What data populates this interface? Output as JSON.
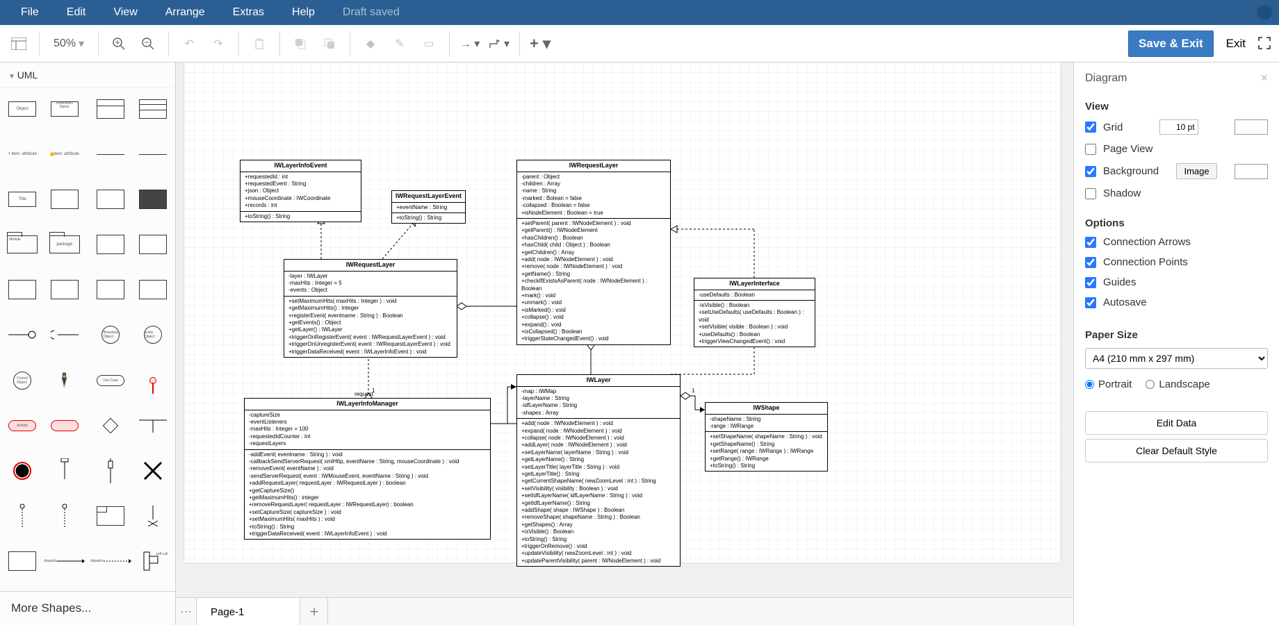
{
  "menu": {
    "file": "File",
    "edit": "Edit",
    "view": "View",
    "arrange": "Arrange",
    "extras": "Extras",
    "help": "Help",
    "draft": "Draft saved"
  },
  "toolbar": {
    "zoom": "50%",
    "save": "Save & Exit",
    "exit": "Exit"
  },
  "sidebar": {
    "category": "UML",
    "more": "More Shapes..."
  },
  "tabs": {
    "page1": "Page-1"
  },
  "rpanel": {
    "title": "Diagram",
    "view_h": "View",
    "grid": "Grid",
    "grid_val": "10 pt",
    "pageview": "Page View",
    "background": "Background",
    "image_btn": "Image",
    "shadow": "Shadow",
    "options_h": "Options",
    "connarrows": "Connection Arrows",
    "connpoints": "Connection Points",
    "guides": "Guides",
    "autosave": "Autosave",
    "papersize_h": "Paper Size",
    "papersize": "A4 (210 mm x 297 mm)",
    "portrait": "Portrait",
    "landscape": "Landscape",
    "editdata": "Edit Data",
    "cleardefault": "Clear Default Style"
  },
  "uml": {
    "iwlayerinfoevent": {
      "title": "IWLayerInfoEvent",
      "attrs": "+requestedId : int\n+requestedEvent : String\n+json : Object\n+mouseCoordinate : IWCoordinate\n+records : int",
      "ops": "+toString() : String"
    },
    "iwrequestlayerevent": {
      "title": "IWRequestLayerEvent",
      "attrs": "+eventName : String",
      "ops": "+toString() : String"
    },
    "iwrequestlayer_box": {
      "title": "IWRequestLayer",
      "attrs": "-layer : IWLayer\n-maxHits : Integer = 5\n-events : Object",
      "ops": "+setMaximumHits( maxHits : Integer ) : void\n+getMaximumHits() : Integer\n+registerEvent( eventname : String ) : Boolean\n+getEvents() : Object\n+getLayer() : IWLayer\n+triggerOnRegisterEvent( event : IWRequestLayerEvent ) : void\n+triggerOnUnregisterEvent( event : IWRequestLayerEvent ) : void\n+triggerDataReceived( event : IWLayerInfoEvent ) : void"
    },
    "iwrequestlayer": {
      "title": "IWRequestLayer",
      "attrs": "-parent : Object\n-children : Array\n-name : String\n-marked : Bolean = false\n-collapsed : Boolean = false\n+isNodeElement : Boolean = true",
      "ops": "+setParent( parent : IWNodeElement ) : void\n+getParent() : IWNodeElement\n+hasChildren() : Boolean\n+hasChild( child : Object ) : Boolean\n+getChildren() : Array\n+add( node : IWNodeElement ) : void\n+remove( node : IWNodeElement ) : void\n+getName() : String\n+checkIfExistsAsParent( node : IWNodeElement ) : Boolean\n+mark() : void\n+unmark() : void\n+isMarked() : void\n+collapse() : void\n+expand() : void\n+isCollapsed() : Boolean\n+triggerStateChangedEvent() : void"
    },
    "iwlayerinterface": {
      "title": "IWLayerInterface",
      "attrs": "-useDefaults : Boolean",
      "ops": "-isVisible() : Boolean\n+setUseDefaults( useDefaults : Boolean ) : void\n+setVisible( visible : Boolean ) : void\n+useDefaults() : Boolean\n+triggerViewChangedEvent() : void"
    },
    "iwlayerinfomanager": {
      "title": "IWLayerInfoManager",
      "attrs": "-captureSize\n-eventListeners\n-maxHits : Integer = 100\n-requestedIdCounter : int\n-requestLayers",
      "ops": "-addEvent( eventname : String ) : void\n-callbackSendServerRequest( xmlHttp, eventName : String, mouseCoordinate ) : void\n-removeEvent( eventName ) : void\n-sendServerRequest( event : IWMouseEvent, eventName : String ) : void\n+addRequestLayer( requestLayer : IWRequestLayer ) : boolean\n+getCaptureSize()\n+getMaximumHits() : integer\n+removeRequestLayer( requestLayer : IWRequestLayer) : boolean\n+setCaptureSize( captureSize ) : void\n+setMaximumHits( maxHits ) : void\n+toString() : String\n+triggerDataReceived( event : IWLayerInfoEvent ) : void"
    },
    "iwlayer": {
      "title": "IWLayer",
      "attrs": "-map : IWMap\n-layerName : String\n-idfLayerName : String\n-shapes : Array",
      "ops": "+add( node : IWNodeElement ) : void\n+expand( node : IWNodeElement ) : void\n+collapse( node : IWNodeElement ) : void\n+addLayer( node : IWNodeElement ) : void\n+setLayerName( layerName : String ) : void\n+getLayerName() : String\n+setLayerTitle( layerTitle : String ) : void\n+getLayerTitle() : String\n+getCurrentShapeName( newZoomLevel : int ) : String\n+setVisibility( visibility : Boolean ) : void\n+setIdfLayerName( idfLayerName : String ) : void\n+getIdfLayerName() : String\n+addShape( shape : IWShape ) : Boolean\n+removeShape( shapeName : String ) : Boolean\n+getShapes() : Array\n+isVisible() : Boolean\n+toString() : String\n+triggerOnRemove() : void\n+updateVisibility( newZoomLevel : int ) : void\n+updateParentVisibility( parent : IWNodeElement ) : void"
    },
    "iwshape": {
      "title": "IWShape",
      "attrs": "-shapeName : String\n-range : IWRange",
      "ops": "+setShapeName( shapeName : String ) : void\n+getShapeName() : String\n+setRange( range : IWRange ) : IWRange\n+getRange() : IWRange\n+toString() : String"
    }
  },
  "edge_labels": {
    "request": "request",
    "one": "1"
  }
}
